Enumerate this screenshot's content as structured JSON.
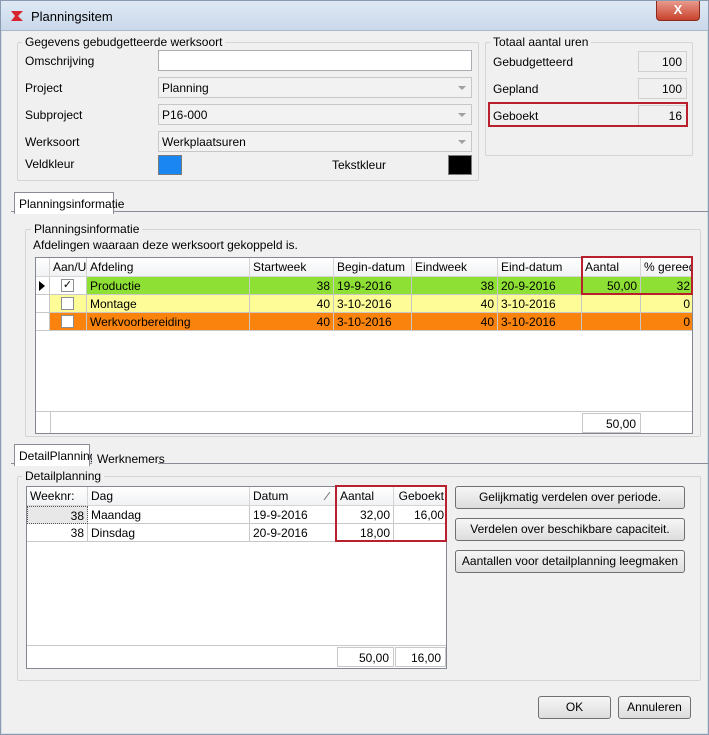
{
  "window": {
    "title": "Planningsitem",
    "close_symbol": "X"
  },
  "werksoort": {
    "group_title": "Gegevens gebudgetteerde werksoort",
    "omschrijving_label": "Omschrijving",
    "omschrijving_value": "",
    "project_label": "Project",
    "project_value": "Planning",
    "subproject_label": "Subproject",
    "subproject_value": "P16-000",
    "werksoort_label": "Werksoort",
    "werksoort_value": "Werkplaatsuren",
    "veldkleur_label": "Veldkleur",
    "veldkleur_color": "#1a86f2",
    "tekstkleur_label": "Tekstkleur",
    "tekstkleur_color": "#000000"
  },
  "totaal": {
    "group_title": "Totaal aantal uren",
    "gebudgetteerd_label": "Gebudgetteerd",
    "gebudgetteerd_value": "100",
    "gepland_label": "Gepland",
    "gepland_value": "100",
    "geboekt_label": "Geboekt",
    "geboekt_value": "16"
  },
  "tab_planningsinformatie": "Planningsinformatie",
  "planning": {
    "group_title": "Planningsinformatie",
    "description": "Afdelingen waaraan deze werksoort gekoppeld is.",
    "columns": [
      "Aan/Uit",
      "Afdeling",
      "Startweek",
      "Begin-datum",
      "Eindweek",
      "Eind-datum",
      "Aantal",
      "% gereed"
    ],
    "rows": [
      {
        "checked": true,
        "check_symbol": "✓",
        "afdeling": "Productie",
        "startweek": "38",
        "begin": "19-9-2016",
        "eindweek": "38",
        "eind": "20-9-2016",
        "aantal": "50,00",
        "gereed": "32",
        "color": "#8fe035"
      },
      {
        "checked": false,
        "check_symbol": "",
        "afdeling": "Montage",
        "startweek": "40",
        "begin": "3-10-2016",
        "eindweek": "40",
        "eind": "3-10-2016",
        "aantal": "",
        "gereed": "0",
        "color": "#fdfc96"
      },
      {
        "checked": false,
        "check_symbol": "",
        "afdeling": "Werkvoorbereiding",
        "startweek": "40",
        "begin": "3-10-2016",
        "eindweek": "40",
        "eind": "3-10-2016",
        "aantal": "",
        "gereed": "0",
        "color": "#f9830c"
      }
    ],
    "footer_total": "50,00"
  },
  "tabs_bottom": {
    "detail": "DetailPlanning",
    "werknemers": "Werknemers"
  },
  "detail": {
    "group_title": "Detailplanning",
    "columns": [
      "Weeknr:",
      "Dag",
      "Datum",
      "Aantal",
      "Geboekt"
    ],
    "rows": [
      {
        "weeknr": "38",
        "dag": "Maandag",
        "datum": "19-9-2016",
        "aantal": "32,00",
        "geboekt": "16,00"
      },
      {
        "weeknr": "38",
        "dag": "Dinsdag",
        "datum": "20-9-2016",
        "aantal": "18,00",
        "geboekt": ""
      }
    ],
    "footer_aantal": "50,00",
    "footer_geboekt": "16,00",
    "btn_gelijkmatig": "Gelijkmatig verdelen over periode.",
    "btn_capaciteit": "Verdelen over beschikbare capaciteit.",
    "btn_leegmaken": "Aantallen voor detailplanning leegmaken"
  },
  "buttons": {
    "ok": "OK",
    "annuleren": "Annuleren"
  },
  "colors": {
    "highlight_box": "#b8202d"
  }
}
